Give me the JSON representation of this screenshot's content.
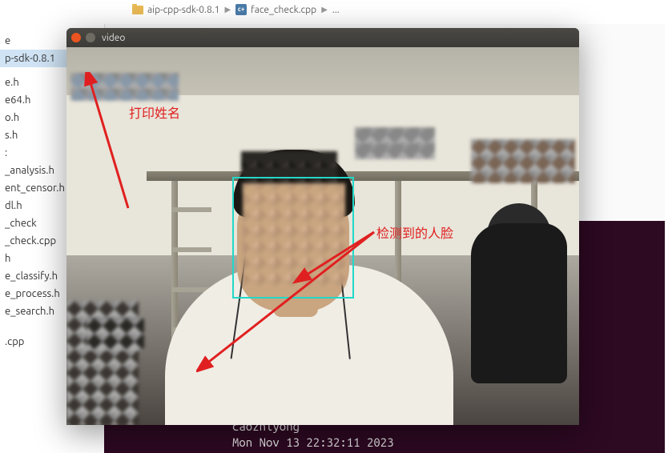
{
  "breadcrumb": {
    "folder": "aip-cpp-sdk-0.8.1",
    "file": "face_check.cpp",
    "more": "..."
  },
  "file_list": [
    {
      "name": "e",
      "highlighted": false
    },
    {
      "name": "p-sdk-0.8.1",
      "highlighted": true
    },
    {
      "name": "",
      "highlighted": false
    },
    {
      "name": "e.h",
      "highlighted": false
    },
    {
      "name": "e64.h",
      "highlighted": false
    },
    {
      "name": "o.h",
      "highlighted": false
    },
    {
      "name": "s.h",
      "highlighted": false
    },
    {
      "name": ":",
      "highlighted": false
    },
    {
      "name": "_analysis.h",
      "highlighted": false
    },
    {
      "name": "ent_censor.h",
      "highlighted": false
    },
    {
      "name": "dl.h",
      "highlighted": false
    },
    {
      "name": "_check",
      "highlighted": false
    },
    {
      "name": "_check.cpp",
      "highlighted": false
    },
    {
      "name": "h",
      "highlighted": false
    },
    {
      "name": "e_classify.h",
      "highlighted": false
    },
    {
      "name": "e_process.h",
      "highlighted": false
    },
    {
      "name": "e_search.h",
      "highlighted": false
    },
    {
      "name": "",
      "highlighted": false
    },
    {
      "name": "",
      "highlighted": false
    },
    {
      "name": ".cpp",
      "highlighted": false
    }
  ],
  "window": {
    "title": "video"
  },
  "annotations": {
    "print_name": "打印姓名",
    "detected_face": "检测到的人脸"
  },
  "terminal": {
    "line1": "caozhiyong",
    "line2": "Mon Nov 13 22:32:11 2023"
  },
  "icons": {
    "cpp": "c+"
  }
}
